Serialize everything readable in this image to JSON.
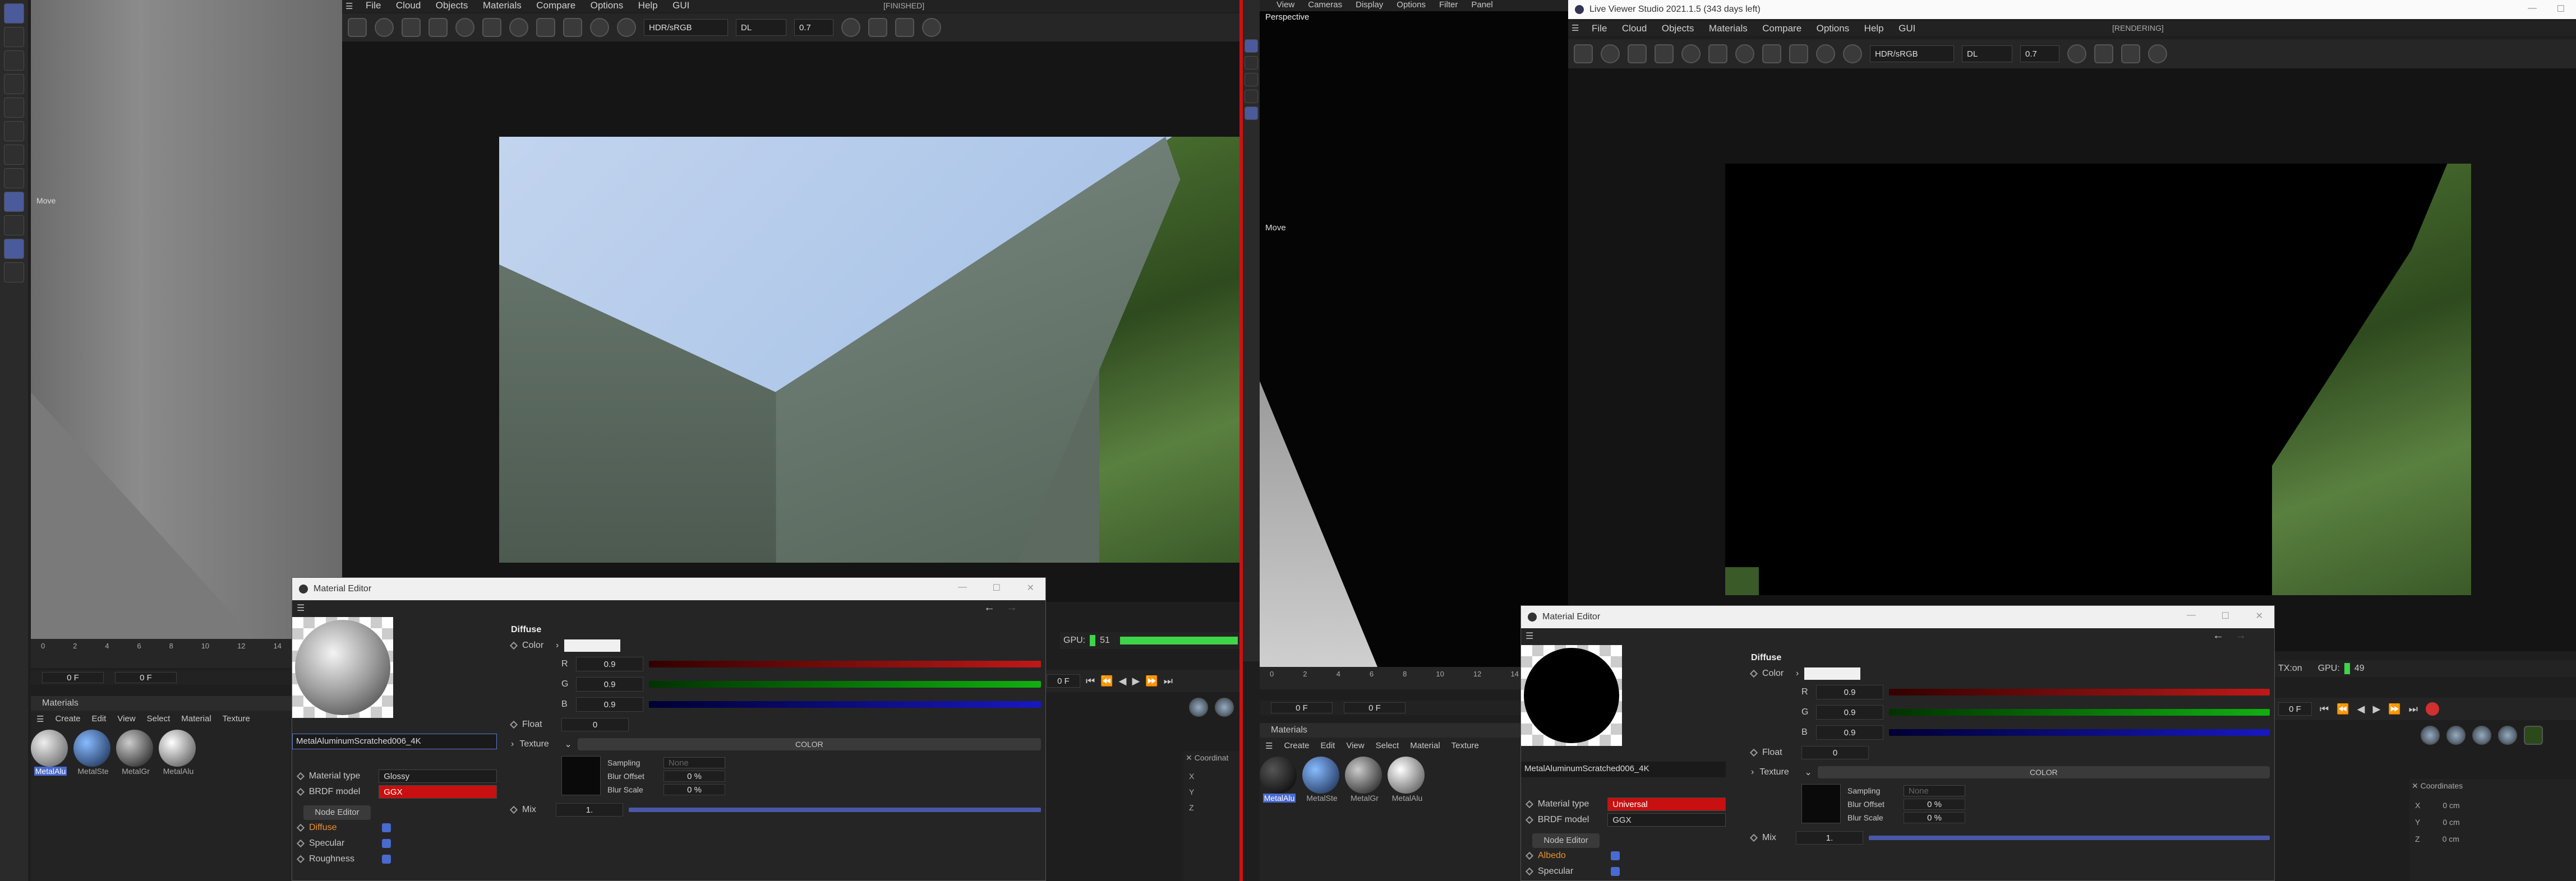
{
  "left": {
    "c4d_hud_move": "Move",
    "lv_menu": [
      "File",
      "Cloud",
      "Objects",
      "Materials",
      "Compare",
      "Options",
      "Help",
      "GUI"
    ],
    "lv_status": "[FINISHED]",
    "lv_color_space": "HDR/sRGB",
    "lv_mode": "DL",
    "lv_value": "0.7",
    "gpu_label": "GPU:",
    "gpu_value": "51",
    "timeline_ticks": [
      "0",
      "2",
      "4",
      "6",
      "8",
      "10",
      "12",
      "14"
    ],
    "frame_start": "0 F",
    "frame_cur": "0 F",
    "frame_right": "0 F",
    "materials_header": "Materials",
    "materials_menu": [
      "Create",
      "Edit",
      "View",
      "Select",
      "Material",
      "Texture"
    ],
    "materials": [
      "MetalAlu",
      "MetalSte",
      "MetalGr",
      "MetalAlu"
    ],
    "coord_label": "Coordinat",
    "coord_axes": [
      "X",
      "Y",
      "Z"
    ],
    "mat_editor": {
      "title": "Material Editor",
      "material_name": "MetalAluminumScratched006_4K",
      "material_type_label": "Material type",
      "material_type_value": "Glossy",
      "brdf_label": "BRDF model",
      "brdf_value": "GGX",
      "node_editor": "Node Editor",
      "channels": [
        "Diffuse",
        "Specular",
        "Roughness"
      ],
      "section": "Diffuse",
      "color_label": "Color",
      "r_label": "R",
      "r_value": "0.9",
      "g_label": "G",
      "g_value": "0.9",
      "b_label": "B",
      "b_value": "0.9",
      "float_label": "Float",
      "float_value": "0",
      "texture_label": "Texture",
      "texture_mode": "COLOR",
      "sampling_label": "Sampling",
      "sampling_value": "None",
      "blur_offset_label": "Blur Offset",
      "blur_offset_value": "0 %",
      "blur_scale_label": "Blur Scale",
      "blur_scale_value": "0 %",
      "mix_label": "Mix",
      "mix_value": "1."
    }
  },
  "right": {
    "top_menu": [
      "View",
      "Cameras",
      "Display",
      "Options",
      "Filter",
      "Panel"
    ],
    "viewport_label": "Perspective",
    "hud_move": "Move",
    "lv_title": "Live Viewer Studio 2021.1.5 (343 days left)",
    "lv_menu": [
      "File",
      "Cloud",
      "Objects",
      "Materials",
      "Compare",
      "Options",
      "Help",
      "GUI"
    ],
    "lv_status": "[RENDERING]",
    "lv_color_space": "HDR/sRGB",
    "lv_mode": "DL",
    "lv_value": "0.7",
    "tx_label": "TX:on",
    "gpu_label": "GPU:",
    "gpu_value": "49",
    "timeline_ticks": [
      "0",
      "2",
      "4",
      "6",
      "8",
      "10",
      "12",
      "14"
    ],
    "frame_start": "0 F",
    "frame_cur": "0 F",
    "frame_right": "0 F",
    "materials_header": "Materials",
    "materials_menu": [
      "Create",
      "Edit",
      "View",
      "Select",
      "Material",
      "Texture"
    ],
    "materials": [
      "MetalAlu",
      "MetalSte",
      "MetalGr",
      "MetalAlu"
    ],
    "coord_label": "Coordinates",
    "coord_axes": [
      "X",
      "Y",
      "Z"
    ],
    "coord_values": [
      "0 cm",
      "0 cm",
      "0 cm"
    ],
    "mat_editor": {
      "title": "Material Editor",
      "material_name": "MetalAluminumScratched006_4K",
      "material_type_label": "Material type",
      "material_type_value": "Universal",
      "brdf_label": "BRDF model",
      "brdf_value": "GGX",
      "node_editor": "Node Editor",
      "channels": [
        "Albedo",
        "Specular"
      ],
      "section": "Diffuse",
      "color_label": "Color",
      "r_label": "R",
      "r_value": "0.9",
      "g_label": "G",
      "g_value": "0.9",
      "b_label": "B",
      "b_value": "0.9",
      "float_label": "Float",
      "float_value": "0",
      "texture_label": "Texture",
      "texture_mode": "COLOR",
      "sampling_label": "Sampling",
      "sampling_value": "None",
      "blur_offset_label": "Blur Offset",
      "blur_offset_value": "0 %",
      "blur_scale_label": "Blur Scale",
      "blur_scale_value": "0 %",
      "mix_label": "Mix",
      "mix_value": "1."
    }
  },
  "colors": {
    "accent": "#4a6ad0",
    "divider_red": "#d01010",
    "gpu_green": "#3fd44a",
    "r_slider": "#c01818",
    "g_slider": "#10b010",
    "b_slider": "#1818c0",
    "mix_slider": "#4a58a8",
    "sky": "#a9c4ea"
  }
}
